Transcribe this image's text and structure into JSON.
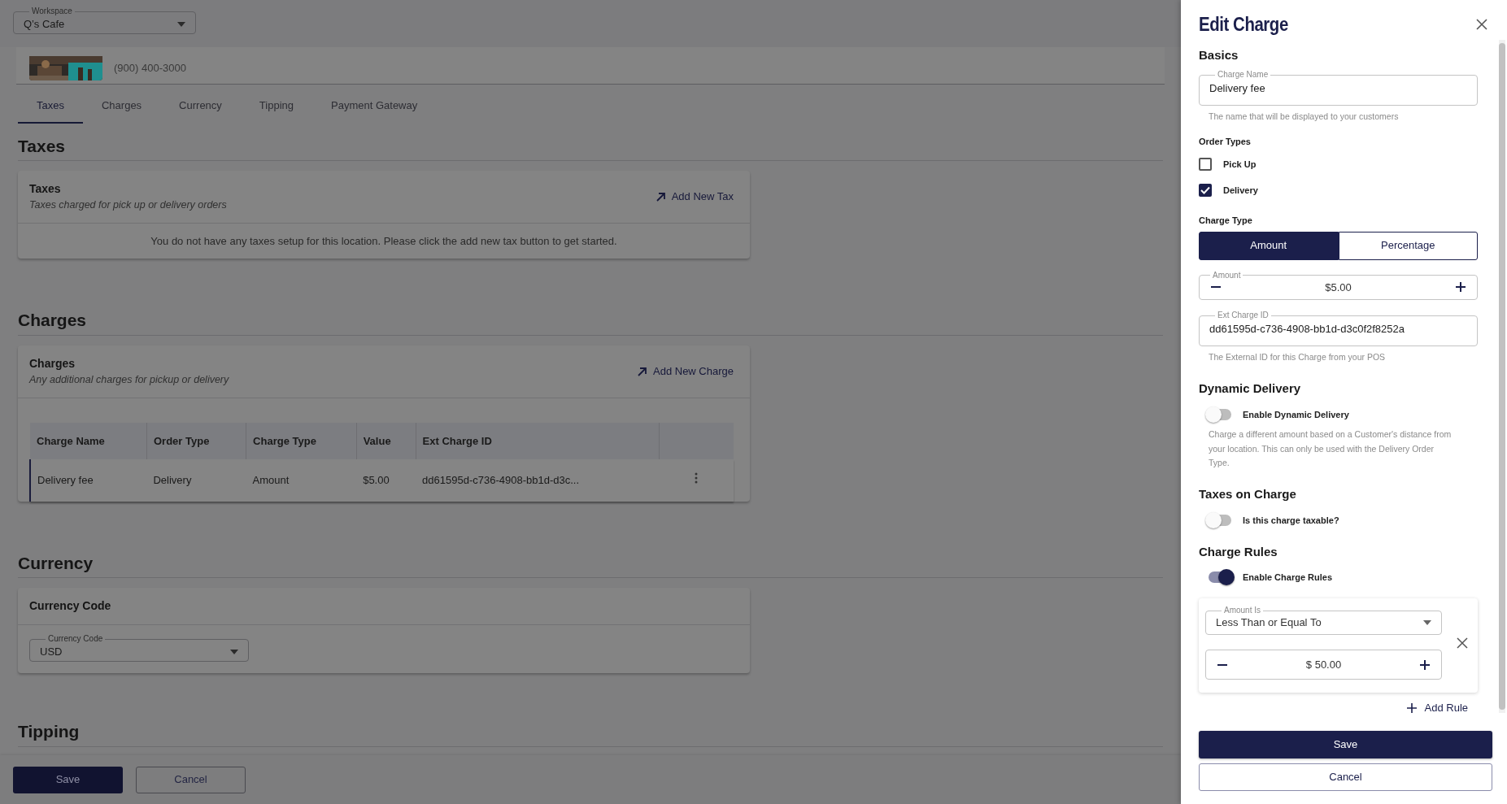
{
  "workspace": {
    "label": "Workspace",
    "value": "Q’s Cafe"
  },
  "location": {
    "phone": "(900) 400-3000"
  },
  "tabs": [
    {
      "label": "Taxes",
      "selected": true
    },
    {
      "label": "Charges",
      "selected": false
    },
    {
      "label": "Currency",
      "selected": false
    },
    {
      "label": "Tipping",
      "selected": false
    },
    {
      "label": "Payment Gateway",
      "selected": false
    }
  ],
  "taxes": {
    "heading": "Taxes",
    "card_title": "Taxes",
    "card_subtitle": "Taxes charged for pick up or delivery orders",
    "action": "Add New Tax",
    "empty_message": "You do not have any taxes setup for this location. Please click the add new tax button to get started."
  },
  "charges": {
    "heading": "Charges",
    "card_title": "Charges",
    "card_subtitle": "Any additional charges for pickup or delivery",
    "action": "Add New Charge",
    "table": {
      "columns": [
        "Charge Name",
        "Order Type",
        "Charge Type",
        "Value",
        "Ext Charge ID"
      ],
      "rows": [
        {
          "cells": [
            "Delivery fee",
            "Delivery",
            "Amount",
            "$5.00",
            "dd61595d-c736-4908-bb1d-d3c..."
          ]
        }
      ]
    }
  },
  "currency": {
    "heading": "Currency",
    "card_title": "Currency Code",
    "field": {
      "label": "Currency Code",
      "value": "USD"
    }
  },
  "tipping": {
    "heading": "Tipping"
  },
  "footer_buttons": [
    {
      "label": "Save",
      "kind": "primary"
    },
    {
      "label": "Cancel",
      "kind": "outline"
    }
  ],
  "drawer": {
    "title": "Edit Charge",
    "basics_heading": "Basics",
    "charge_name": {
      "label": "Charge Name",
      "value": "Delivery fee",
      "help": "The name that will be displayed to your customers"
    },
    "order_types": {
      "heading": "Order Types",
      "options": [
        {
          "label": "Pick Up",
          "checked": false
        },
        {
          "label": "Delivery",
          "checked": true
        }
      ]
    },
    "charge_type": {
      "heading": "Charge Type",
      "options": [
        {
          "label": "Amount",
          "selected": true
        },
        {
          "label": "Percentage",
          "selected": false
        }
      ]
    },
    "amount": {
      "label": "Amount",
      "value": "$5.00"
    },
    "ext_id": {
      "label": "Ext Charge ID",
      "value": "dd61595d-c736-4908-bb1d-d3c0f2f8252a",
      "help": "The External ID for this Charge from your POS"
    },
    "dynamic_delivery": {
      "heading": "Dynamic Delivery",
      "toggle": {
        "label": "Enable Dynamic Delivery",
        "on": false
      },
      "description": "Charge a different amount based on a Customer's distance from your location. This can only be used with the Delivery Order Type."
    },
    "taxes_on_charge": {
      "heading": "Taxes on Charge",
      "toggle": {
        "label": "Is this charge taxable?",
        "on": false
      }
    },
    "charge_rules": {
      "heading": "Charge Rules",
      "toggle": {
        "label": "Enable Charge Rules",
        "on": true
      },
      "rules": [
        {
          "condition": {
            "label": "Amount Is",
            "value": "Less Than or Equal To"
          },
          "amount": "$ 50.00"
        }
      ],
      "add_rule": "Add Rule"
    },
    "buttons": [
      {
        "label": "Save",
        "kind": "primary"
      },
      {
        "label": "Cancel",
        "kind": "outline"
      }
    ]
  }
}
